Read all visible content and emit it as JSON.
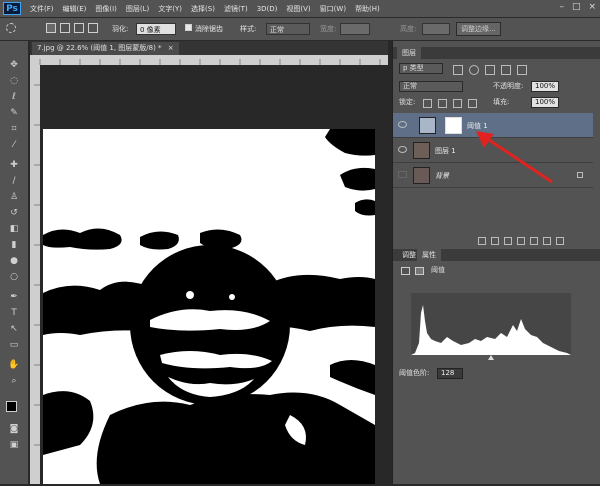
{
  "menubar": {
    "logo": "Ps",
    "items": [
      "文件(F)",
      "编辑(E)",
      "图像(I)",
      "图层(L)",
      "文字(Y)",
      "选择(S)",
      "滤镜(T)",
      "3D(D)",
      "视图(V)",
      "窗口(W)",
      "帮助(H)"
    ]
  },
  "options": {
    "feather_label": "羽化:",
    "feather_value": "0 像素",
    "antialias_label": "消除锯齿",
    "style_label": "样式:",
    "style_value": "正常",
    "width_label": "宽度:",
    "height_label": "高度:",
    "refine_edge_label": "调整边缘..."
  },
  "document": {
    "tab_title": "7.jpg @ 22.6% (阈值 1, 图层蒙版/8) *",
    "close": "×"
  },
  "layers_panel": {
    "tab_label": "图层",
    "filter_label": "p 类型",
    "blend_mode": "正常",
    "opacity_label": "不透明度:",
    "opacity_value": "100%",
    "lock_label": "锁定:",
    "fill_label": "填充:",
    "fill_value": "100%",
    "layers": [
      {
        "name": "阈值 1",
        "selected": true
      },
      {
        "name": "图层 1",
        "selected": false
      },
      {
        "name": "背景",
        "selected": false
      }
    ]
  },
  "properties_panel": {
    "tabs": [
      "调整",
      "属性"
    ],
    "adjustment_name": "阈值",
    "threshold_label": "阈值色阶:",
    "threshold_value": "128"
  },
  "colors": {
    "selected_row": "#5e6f87",
    "arrow": "#e0231f"
  }
}
